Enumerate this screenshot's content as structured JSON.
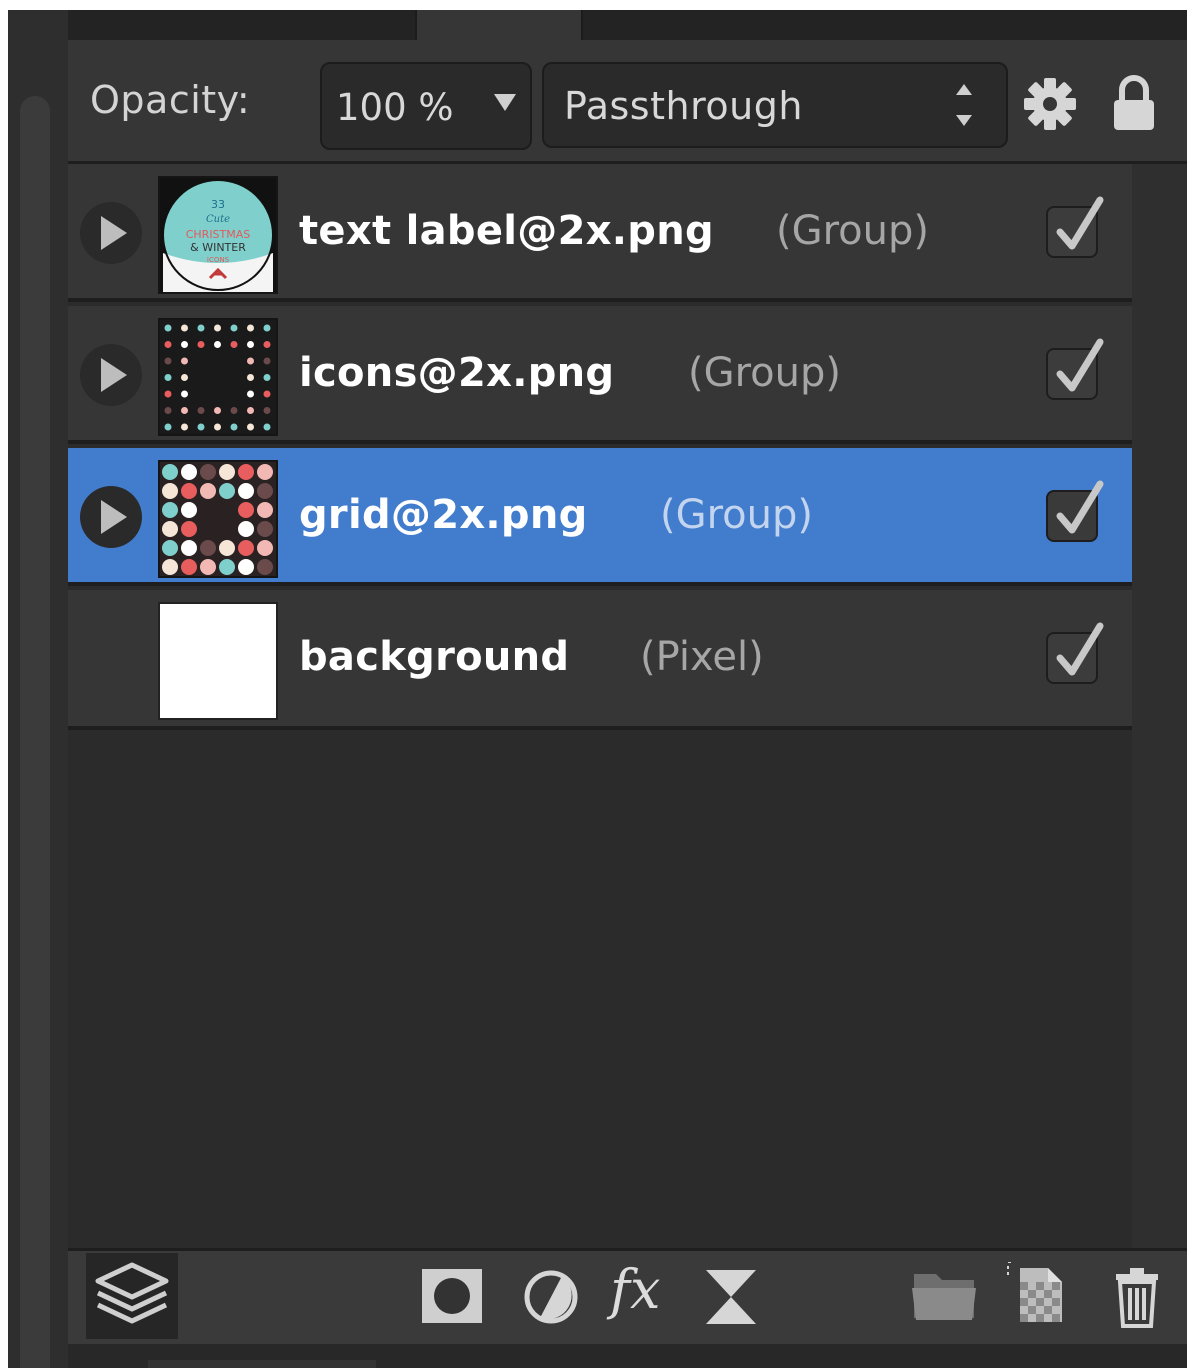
{
  "toolbar": {
    "opacity_label": "Opacity:",
    "opacity_value": "100 %",
    "blend_mode": "Passthrough",
    "settings_icon": "gear-icon",
    "lock_icon": "lock-icon"
  },
  "layers": [
    {
      "name": "text label@2x.png",
      "type": "(Group)",
      "expandable": true,
      "visible": true,
      "selected": false
    },
    {
      "name": "icons@2x.png",
      "type": "(Group)",
      "expandable": true,
      "visible": true,
      "selected": false
    },
    {
      "name": "grid@2x.png",
      "type": "(Group)",
      "expandable": true,
      "visible": true,
      "selected": true
    },
    {
      "name": "background",
      "type": "(Pixel)",
      "expandable": false,
      "visible": true,
      "selected": false
    }
  ],
  "thumb_text": {
    "number": "33",
    "line1": "Cute",
    "line2": "CHRISTMAS",
    "line3": "& WINTER",
    "line4": "ICONS"
  },
  "bottom_bar": {
    "icons": [
      "layers-icon",
      "mask-icon",
      "adjustment-icon",
      "fx-icon",
      "live-filter-icon",
      "group-folder-icon",
      "add-pixel-layer-icon",
      "trash-icon"
    ],
    "fx_label": "fx"
  },
  "colors": {
    "panel_bg": "#363636",
    "selection": "#427ccd",
    "text": "#ffffff",
    "muted_text": "#a6a6a6"
  }
}
